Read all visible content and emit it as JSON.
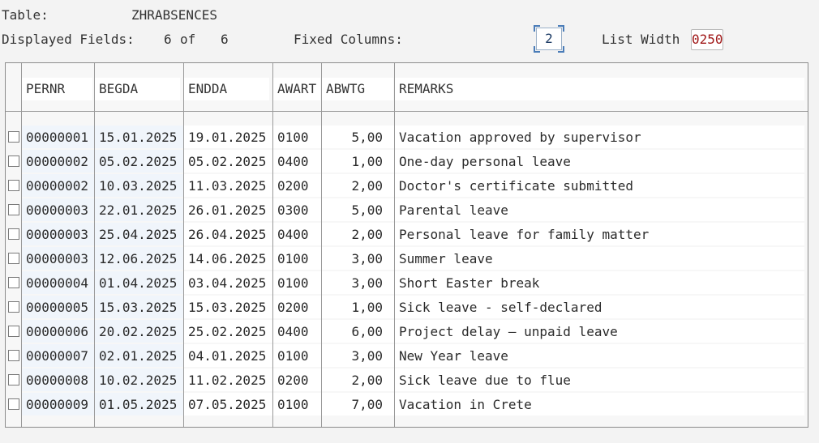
{
  "header": {
    "table_label": "Table:",
    "table_name": "ZHRABSENCES",
    "displayed_fields_label": "Displayed Fields:",
    "displayed_count": "6",
    "of_label": "of",
    "total_count": "6",
    "fixed_columns_label": "Fixed Columns:",
    "fixed_columns_value": "2",
    "list_width_label": "List Width",
    "list_width_value": "0250"
  },
  "columns": [
    "PERNR",
    "BEGDA",
    "ENDDA",
    "AWART",
    "ABWTG",
    "REMARKS"
  ],
  "rows": [
    [
      "00000001",
      "15.01.2025",
      "19.01.2025",
      "0100",
      "5,00",
      "Vacation approved by supervisor"
    ],
    [
      "00000002",
      "05.02.2025",
      "05.02.2025",
      "0400",
      "1,00",
      "One-day personal leave"
    ],
    [
      "00000002",
      "10.03.2025",
      "11.03.2025",
      "0200",
      "2,00",
      "Doctor's certificate submitted"
    ],
    [
      "00000003",
      "22.01.2025",
      "26.01.2025",
      "0300",
      "5,00",
      "Parental leave"
    ],
    [
      "00000003",
      "25.04.2025",
      "26.04.2025",
      "0400",
      "2,00",
      "Personal leave for family matter"
    ],
    [
      "00000003",
      "12.06.2025",
      "14.06.2025",
      "0100",
      "3,00",
      "Summer leave"
    ],
    [
      "00000004",
      "01.04.2025",
      "03.04.2025",
      "0100",
      "3,00",
      "Short Easter break"
    ],
    [
      "00000005",
      "15.03.2025",
      "15.03.2025",
      "0200",
      "1,00",
      "Sick leave - self-declared"
    ],
    [
      "00000006",
      "20.02.2025",
      "25.02.2025",
      "0400",
      "6,00",
      "Project delay – unpaid leave"
    ],
    [
      "00000007",
      "02.01.2025",
      "04.01.2025",
      "0100",
      "3,00",
      "New Year leave"
    ],
    [
      "00000008",
      "10.02.2025",
      "11.02.2025",
      "0200",
      "2,00",
      "Sick leave due to flue"
    ],
    [
      "00000009",
      "01.05.2025",
      "07.05.2025",
      "0100",
      "7,00",
      "Vacation in Crete"
    ]
  ]
}
